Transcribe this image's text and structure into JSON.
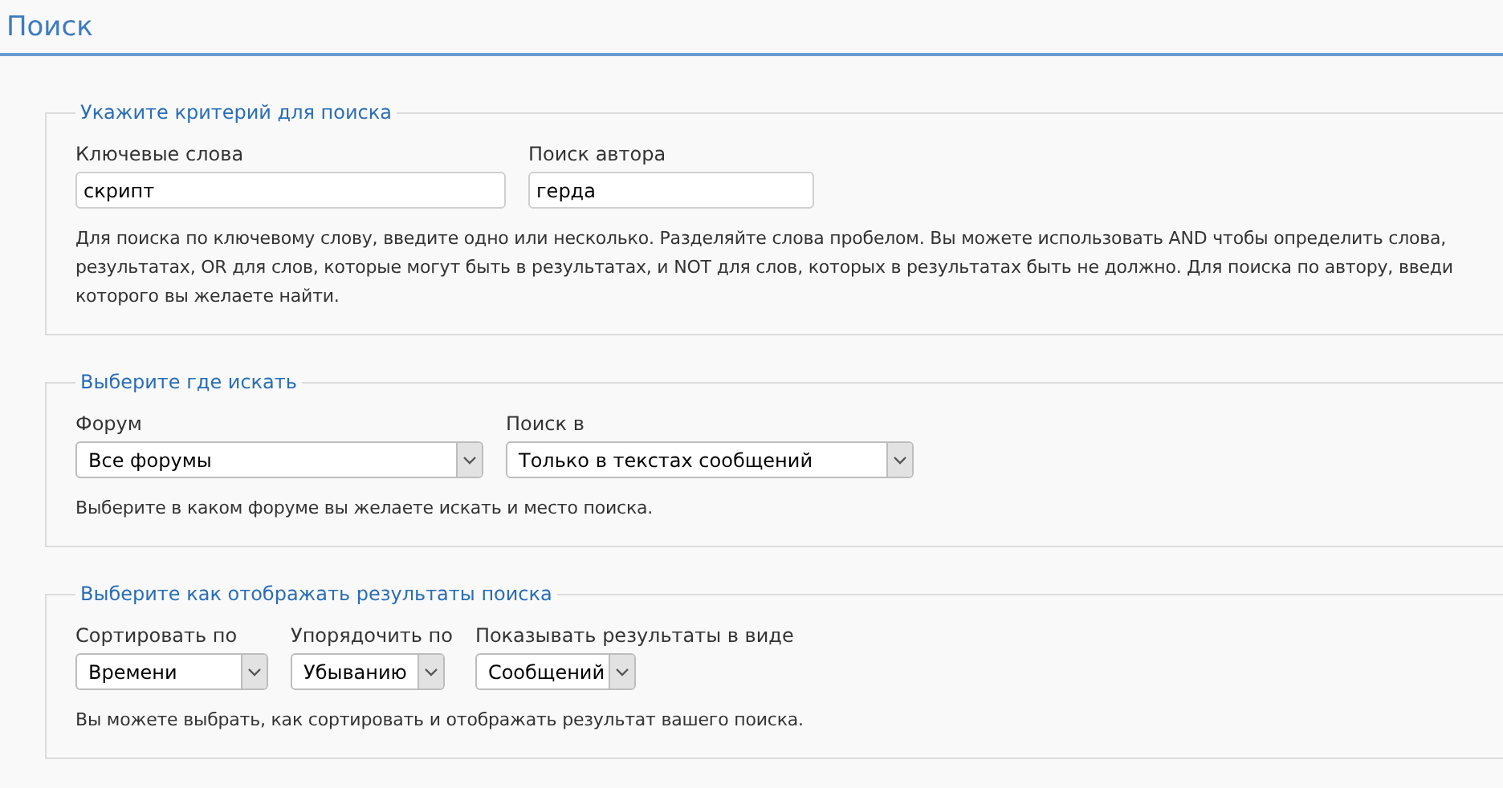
{
  "page_title": "Поиск",
  "sections": [
    {
      "legend": "Укажите критерий для поиска",
      "fields": [
        {
          "kind": "input",
          "label": "Ключевые слова",
          "value": "скрипт"
        },
        {
          "kind": "input",
          "label": "Поиск автора",
          "value": "герда"
        }
      ],
      "help_lines": [
        "Для поиска по ключевому слову, введите одно или несколько. Разделяйте слова пробелом. Вы можете использовать AND чтобы определить слова,",
        "результатах, OR для слов, которые могут быть в результатах, и NOT для слов, которых в результатах быть не должно. Для поиска по автору, введи",
        "которого вы желаете найти."
      ]
    },
    {
      "legend": "Выберите где искать",
      "fields": [
        {
          "kind": "select",
          "label": "Форум",
          "value": "Все форумы"
        },
        {
          "kind": "select",
          "label": "Поиск в",
          "value": "Только в текстах сообщений"
        }
      ],
      "help_lines": [
        "Выберите в каком форуме вы желаете искать и место поиска."
      ]
    },
    {
      "legend": "Выберите как отображать результаты поиска",
      "fields": [
        {
          "kind": "select",
          "label": "Сортировать по",
          "value": "Времени"
        },
        {
          "kind": "select",
          "label": "Упорядочить по",
          "value": "Убыванию"
        },
        {
          "kind": "select",
          "label": "Показывать результаты в виде",
          "value": "Сообщений"
        }
      ],
      "help_lines": [
        "Вы можете выбрать, как сортировать и отображать результат вашего поиска."
      ]
    }
  ]
}
